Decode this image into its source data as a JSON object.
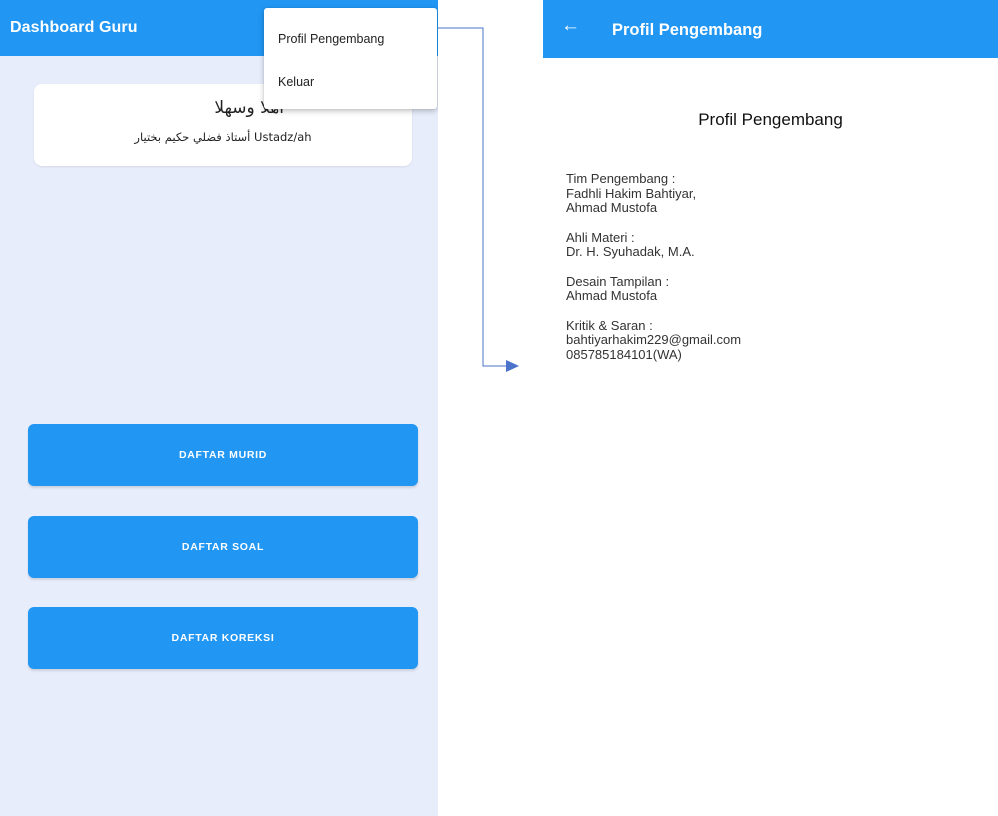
{
  "left_screen": {
    "appbar_title": "Dashboard Guru",
    "menu": {
      "items": [
        "Profil Pengembang",
        "Keluar"
      ]
    },
    "welcome": {
      "greeting": "أهلا وسهلا",
      "name_line": "أستاذ فضلي حكيم بختيار Ustadz/ah"
    },
    "buttons": [
      "DAFTAR MURID",
      "DAFTAR SOAL",
      "DAFTAR KOREKSI"
    ]
  },
  "right_screen": {
    "back_icon": "arrow-left-icon",
    "appbar_title": "Profil Pengembang",
    "heading": "Profil Pengembang",
    "sections": [
      {
        "label": "Tim Pengembang :",
        "lines": [
          "Fadhli Hakim Bahtiyar,",
          "Ahmad Mustofa"
        ]
      },
      {
        "label": "Ahli Materi :",
        "lines": [
          "Dr. H. Syuhadak, M.A."
        ]
      },
      {
        "label": "Desain Tampilan :",
        "lines": [
          "Ahmad Mustofa"
        ]
      },
      {
        "label": "Kritik & Saran :",
        "lines": [
          "bahtiyarhakim229@gmail.com",
          "085785184101(WA)"
        ]
      }
    ]
  },
  "colors": {
    "primary": "#2196f3",
    "left_background": "#e8edfb",
    "connector": "#4a74c9"
  }
}
